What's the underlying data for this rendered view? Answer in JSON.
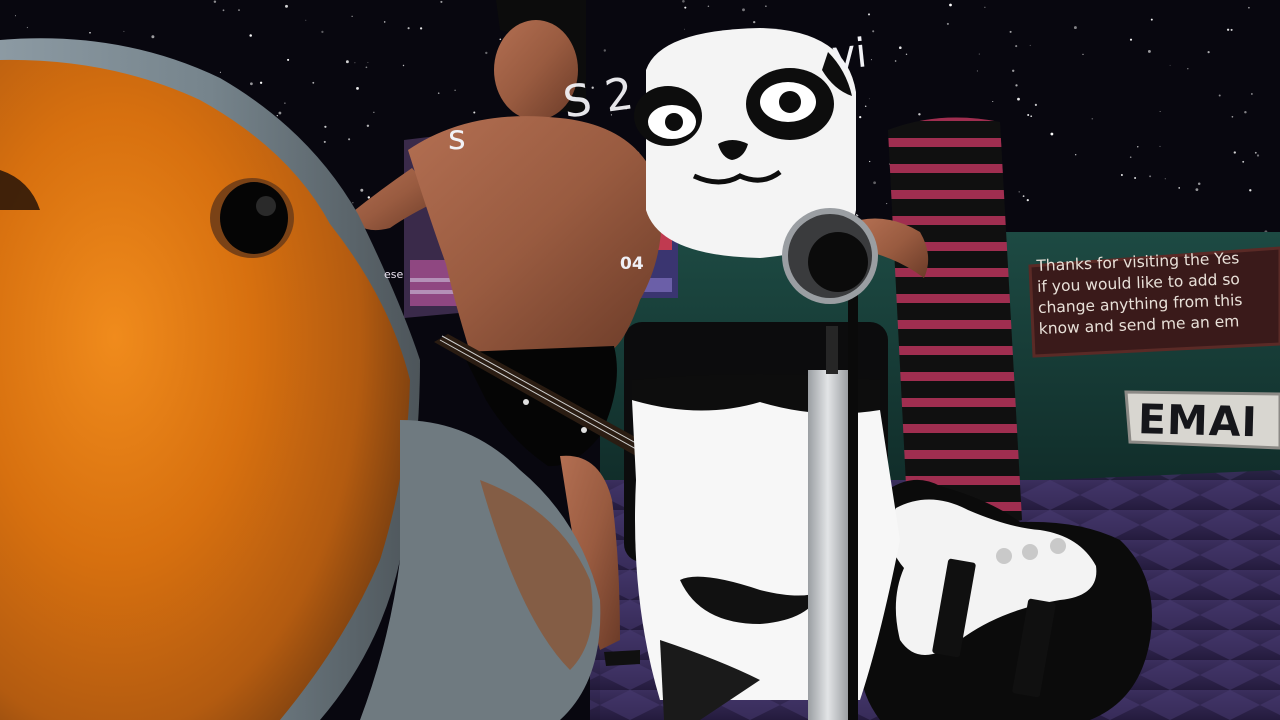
{
  "scene": {
    "world_title": "S 2",
    "world_title_tail": "vi",
    "world_title_sub": "s",
    "sign_lines": [
      "Thanks for visiting the Yes",
      "if you would like to add so",
      "change anything from this",
      "know and send me an em"
    ],
    "email_label": "EMAI",
    "poster_text_left": "ese",
    "poster_text_right": "04"
  }
}
